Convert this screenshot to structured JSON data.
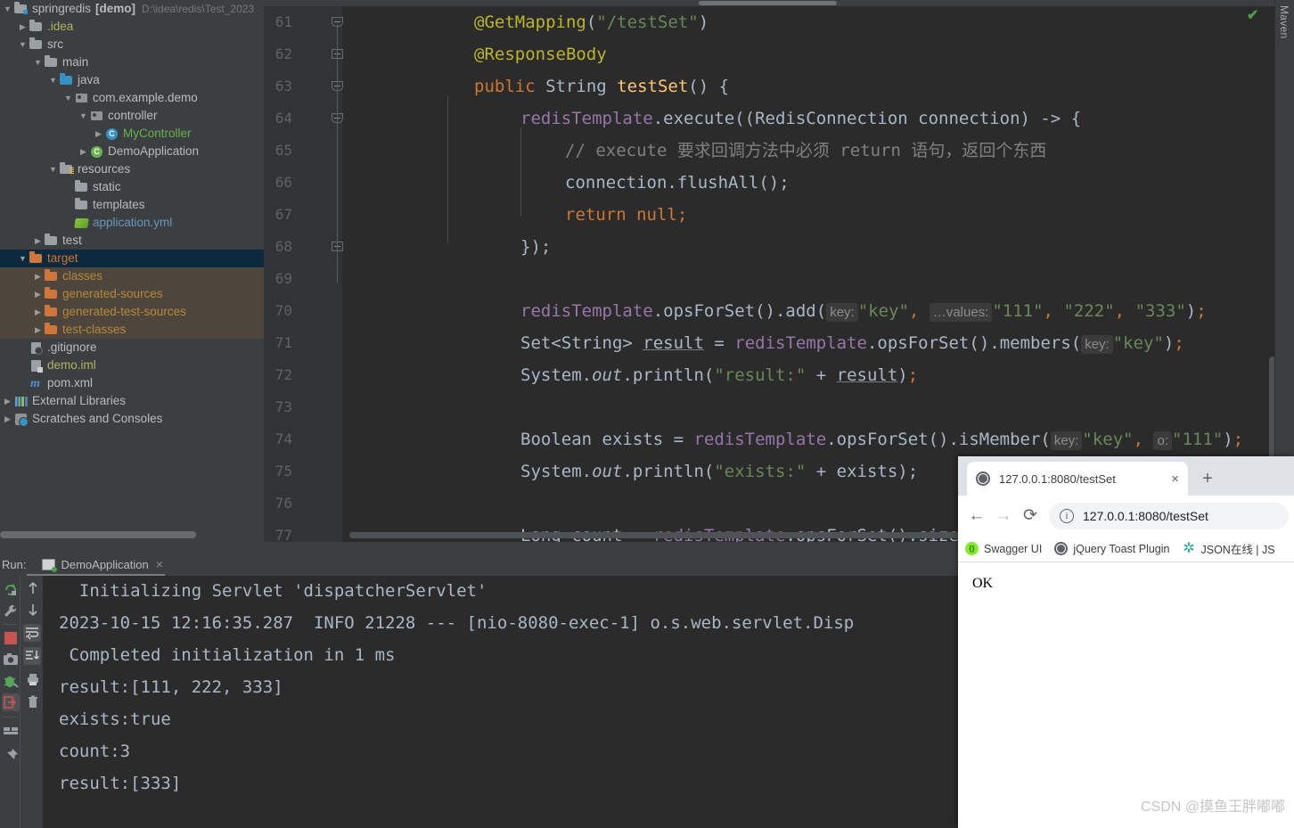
{
  "sidebar": {
    "tree": [
      {
        "depth": 0,
        "arrow": "v",
        "icon": "folder-module",
        "label": "springredis",
        "bold": "[demo]",
        "dim": "D:\\idea\\redis\\Test_2023",
        "color": "#bbbbbb",
        "state": "none"
      },
      {
        "depth": 1,
        "arrow": ">",
        "icon": "folder",
        "label": ".idea",
        "color": "#b5b35c",
        "state": "none"
      },
      {
        "depth": 1,
        "arrow": "v",
        "icon": "folder",
        "label": "src",
        "color": "#bbbbbb",
        "state": "none"
      },
      {
        "depth": 2,
        "arrow": "v",
        "icon": "folder",
        "label": "main",
        "color": "#bbbbbb",
        "state": "none"
      },
      {
        "depth": 3,
        "arrow": "v",
        "icon": "folder-source",
        "label": "java",
        "color": "#bbbbbb",
        "state": "none"
      },
      {
        "depth": 4,
        "arrow": "v",
        "icon": "package",
        "label": "com.example.demo",
        "color": "#bbbbbb",
        "state": "none"
      },
      {
        "depth": 5,
        "arrow": "v",
        "icon": "package",
        "label": "controller",
        "color": "#bbbbbb",
        "state": "none"
      },
      {
        "depth": 6,
        "arrow": ">",
        "icon": "class",
        "label": "MyController",
        "color": "#6ab04c",
        "state": "none"
      },
      {
        "depth": 5,
        "arrow": ">",
        "icon": "spring-class",
        "label": "DemoApplication",
        "color": "#bbbbbb",
        "state": "none"
      },
      {
        "depth": 3,
        "arrow": "v",
        "icon": "folder-resources",
        "label": "resources",
        "color": "#bbbbbb",
        "state": "none"
      },
      {
        "depth": 4,
        "arrow": "",
        "icon": "folder",
        "label": "static",
        "color": "#bbbbbb",
        "state": "none"
      },
      {
        "depth": 4,
        "arrow": "",
        "icon": "folder",
        "label": "templates",
        "color": "#bbbbbb",
        "state": "none"
      },
      {
        "depth": 4,
        "arrow": "",
        "icon": "yml",
        "label": "application.yml",
        "color": "#6897bb",
        "state": "none"
      },
      {
        "depth": 2,
        "arrow": ">",
        "icon": "folder",
        "label": "test",
        "color": "#bbbbbb",
        "state": "none"
      },
      {
        "depth": 1,
        "arrow": "v",
        "icon": "folder-excluded",
        "label": "target",
        "color": "#cc7832",
        "state": "selected"
      },
      {
        "depth": 2,
        "arrow": ">",
        "icon": "folder-excluded",
        "label": "classes",
        "color": "#b5893a",
        "state": "child"
      },
      {
        "depth": 2,
        "arrow": ">",
        "icon": "folder-excluded",
        "label": "generated-sources",
        "color": "#b5893a",
        "state": "child"
      },
      {
        "depth": 2,
        "arrow": ">",
        "icon": "folder-excluded",
        "label": "generated-test-sources",
        "color": "#b5893a",
        "state": "child"
      },
      {
        "depth": 2,
        "arrow": ">",
        "icon": "folder-excluded",
        "label": "test-classes",
        "color": "#b5893a",
        "state": "child"
      },
      {
        "depth": 1,
        "arrow": "",
        "icon": "gitignore-file",
        "label": ".gitignore",
        "color": "#bbbbbb",
        "state": "none"
      },
      {
        "depth": 1,
        "arrow": "",
        "icon": "iml-file",
        "label": "demo.iml",
        "color": "#b5b35c",
        "state": "none"
      },
      {
        "depth": 1,
        "arrow": "",
        "icon": "maven-file",
        "label": "pom.xml",
        "color": "#bbbbbb",
        "state": "none"
      },
      {
        "depth": 0,
        "arrow": ">",
        "icon": "libraries",
        "label": "External Libraries",
        "color": "#bbbbbb",
        "state": "none"
      },
      {
        "depth": 0,
        "arrow": ">",
        "icon": "scratches",
        "label": "Scratches and Consoles",
        "color": "#bbbbbb",
        "state": "none"
      }
    ]
  },
  "editor": {
    "first_line": 61,
    "lines": [
      {
        "n": 61,
        "fold": "pointy"
      },
      {
        "n": 62,
        "fold": "flat"
      },
      {
        "n": 63,
        "fold": "pointy"
      },
      {
        "n": 64,
        "fold": "pointy"
      },
      {
        "n": 65,
        "fold": ""
      },
      {
        "n": 66,
        "fold": ""
      },
      {
        "n": 67,
        "fold": ""
      },
      {
        "n": 68,
        "fold": "flat"
      },
      {
        "n": 69,
        "fold": ""
      },
      {
        "n": 70,
        "fold": ""
      },
      {
        "n": 71,
        "fold": ""
      },
      {
        "n": 72,
        "fold": ""
      },
      {
        "n": 73,
        "fold": ""
      },
      {
        "n": 74,
        "fold": ""
      },
      {
        "n": 75,
        "fold": ""
      },
      {
        "n": 76,
        "fold": ""
      },
      {
        "n": 77,
        "fold": ""
      }
    ],
    "code": {
      "l61_annotation": "@GetMapping",
      "l61_arg": "\"/testSet\"",
      "l62": "@ResponseBody",
      "l63_kw": "public",
      "l63_type": "String",
      "l63_method": "testSet",
      "l64_a": "redisTemplate",
      "l64_b": ".execute((",
      "l64_c": "RedisConnection",
      "l64_d": " connection) -> {",
      "l65_comment": "// execute 要求回调方法中必须 return 语句，返回个东西",
      "l66": "connection.flushAll();",
      "l67_kw": "return",
      "l67_val": "null;",
      "l68": "});",
      "l70_a": "redisTemplate",
      "l70_b": ".opsForSet().add(",
      "l70_hint1": "key:",
      "l70_s1": "\"key\"",
      "l70_hint2": "…values:",
      "l70_s2": "\"111\"",
      "l70_s3": "\"222\"",
      "l70_s4": "\"333\"",
      "l71_type": "Set<String>",
      "l71_var": "result",
      "l71_a": "redisTemplate",
      "l71_b": ".opsForSet().members(",
      "l71_hint": "key:",
      "l71_s": "\"key\"",
      "l72_a": "System.",
      "l72_out": "out",
      "l72_b": ".println(",
      "l72_s": "\"result:\"",
      "l72_var": "result",
      "l74_type": "Boolean",
      "l74_var": " exists = ",
      "l74_a": "redisTemplate",
      "l74_b": ".opsForSet().isMember(",
      "l74_hint1": "key:",
      "l74_s1": "\"key\"",
      "l74_hint2": "o:",
      "l74_s2": "\"111\"",
      "l75_a": "System.",
      "l75_out": "out",
      "l75_b": ".println(",
      "l75_s": "\"exists:\"",
      "l75_var": " + exists);",
      "l77_type": "Long",
      "l77_var": " count = ",
      "l77_a": "redisTemplate",
      "l77_b": ".opsForSet().size("
    }
  },
  "maven": {
    "label": "Maven"
  },
  "run_panel": {
    "run_label": "Run:",
    "tab_name": "DemoApplication",
    "close_label": "×",
    "console_lines": [
      "  Initializing Servlet 'dispatcherServlet'",
      "2023-10-15 12:16:35.287  INFO 21228 --- [nio-8080-exec-1] o.s.web.servlet.Disp",
      " Completed initialization in 1 ms",
      "result:[111, 222, 333]",
      "exists:true",
      "count:3",
      "result:[333]"
    ]
  },
  "browser": {
    "tab_title": "127.0.0.1:8080/testSet",
    "tab_close": "×",
    "new_tab": "+",
    "back": "←",
    "forward": "→",
    "reload": "⟳",
    "info": "i",
    "url": "127.0.0.1:8080/testSet",
    "bookmarks": [
      {
        "label": "Swagger UI",
        "icon": "swagger-icon"
      },
      {
        "label": "jQuery Toast Plugin",
        "icon": "globe-icon"
      },
      {
        "label": "JSON在线 | JS",
        "icon": "json-icon"
      }
    ],
    "body_text": "OK"
  },
  "watermark": {
    "text": "CSDN @摸鱼王胖嘟嘟"
  },
  "colors": {
    "ide_bg": "#3c3f41",
    "editor_bg": "#2b2b2b",
    "selection_blue": "#0d293e",
    "excluded_brown": "#4e463c",
    "keyword": "#cc7832",
    "string": "#6a8759",
    "annotation": "#bbb529",
    "field": "#9876aa",
    "method": "#ffc66d",
    "plain": "#a9b7c6"
  }
}
